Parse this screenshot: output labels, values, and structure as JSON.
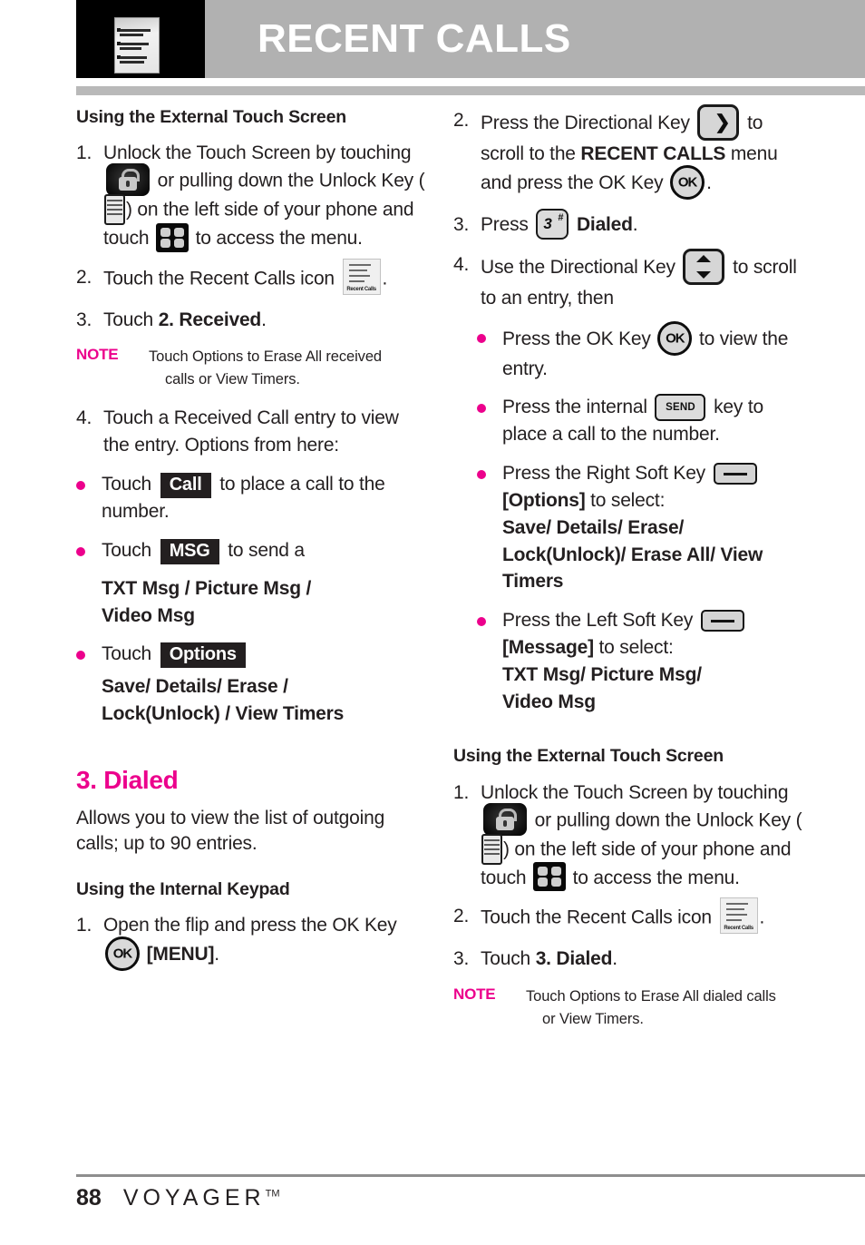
{
  "header": {
    "title": "RECENT CALLS",
    "thumbnail_alt": "page-thumbnail"
  },
  "left_column": {
    "heading": "Using the External Touch Screen",
    "steps": [
      {
        "num": "1.",
        "p1": "Unlock the Touch Screen by touching",
        "p2": "or pulling down the Unlock Key (",
        "p3": ") on the left side of your phone and touch",
        "p4": "to access the menu."
      },
      {
        "num": "2.",
        "p1": "Touch the Recent Calls icon",
        "p2": "."
      },
      {
        "num": "3.",
        "p1": "Touch ",
        "bold": "2. Received",
        "p2": "."
      }
    ],
    "note": {
      "label": "NOTE",
      "line1": "Touch Options to Erase All received",
      "line2": "calls or View Timers."
    },
    "step4": {
      "num": "4.",
      "text": "Touch a Received Call entry to view the entry. Options from here:"
    },
    "bullets": [
      {
        "pre": "Touch",
        "tag": "Call",
        "post": "to place a call to the number."
      },
      {
        "pre": "Touch",
        "tag": "MSG",
        "post": "to send a",
        "bold_lines": [
          "TXT Msg / Picture Msg /",
          "Video Msg"
        ]
      },
      {
        "pre": "Touch",
        "tag": "Options",
        "post": "",
        "bold_lines": [
          "Save/ Details/ Erase /",
          "Lock(Unlock) / View Timers"
        ]
      }
    ],
    "section": {
      "title": "3. Dialed",
      "description": "Allows you to view the list of outgoing calls; up to 90 entries.",
      "sub_heading": "Using the Internal Keypad",
      "step1": {
        "num": "1.",
        "p1": "Open the flip and press the OK Key",
        "p2": "[MENU]",
        "p3": "."
      }
    }
  },
  "right_column": {
    "step2": {
      "num": "2.",
      "p1": "Press the Directional Key",
      "p2": "to scroll to the",
      "bold": "RECENT CALLS",
      "p3": "menu and press the OK Key",
      "p4": "."
    },
    "step3": {
      "num": "3.",
      "p1": "Press",
      "key_num": "3",
      "key_sym": "#",
      "bold": "Dialed",
      "p2": "."
    },
    "step4": {
      "num": "4.",
      "p1": "Use the Directional Key",
      "p2": "to scroll to an entry, then"
    },
    "bullets": [
      {
        "pre": "Press the OK Key",
        "post": "to view the entry."
      },
      {
        "pre": "Press the internal",
        "key_label": "SEND",
        "post": "key to place a call to the number."
      },
      {
        "pre": "Press the Right Soft Key",
        "bold1": "[Options]",
        "mid": "to select:",
        "bold_lines": [
          "Save/ Details/ Erase/",
          "Lock(Unlock)/ Erase All/ View",
          "Timers"
        ]
      },
      {
        "pre": "Press the Left Soft Key",
        "bold1": "[Message]",
        "mid": "to select:",
        "bold_lines": [
          "TXT Msg/ Picture Msg/",
          "Video Msg"
        ]
      }
    ],
    "heading2": "Using the External Touch Screen",
    "steps2": [
      {
        "num": "1.",
        "p1": "Unlock the Touch Screen by touching",
        "p2": "or pulling down the Unlock Key (",
        "p3": ") on the left side of your phone and touch",
        "p4": "to access the menu."
      },
      {
        "num": "2.",
        "p1": "Touch the Recent Calls icon",
        "p2": "."
      },
      {
        "num": "3.",
        "p1": "Touch ",
        "bold": "3. Dialed",
        "p2": "."
      }
    ],
    "note": {
      "label": "NOTE",
      "line1": "Touch Options to Erase All dialed calls",
      "line2": "or View Timers."
    }
  },
  "icons": {
    "recent_calls_label": "Recent Calls",
    "ok_label": "OK",
    "send_label": "SEND",
    "chevron_right": "❯"
  },
  "footer": {
    "page_number": "88",
    "brand": "VOYAGER",
    "trademark": "TM"
  },
  "colors": {
    "accent": "#ec008c",
    "header_bg": "#b1b1b1",
    "text": "#231f20"
  }
}
